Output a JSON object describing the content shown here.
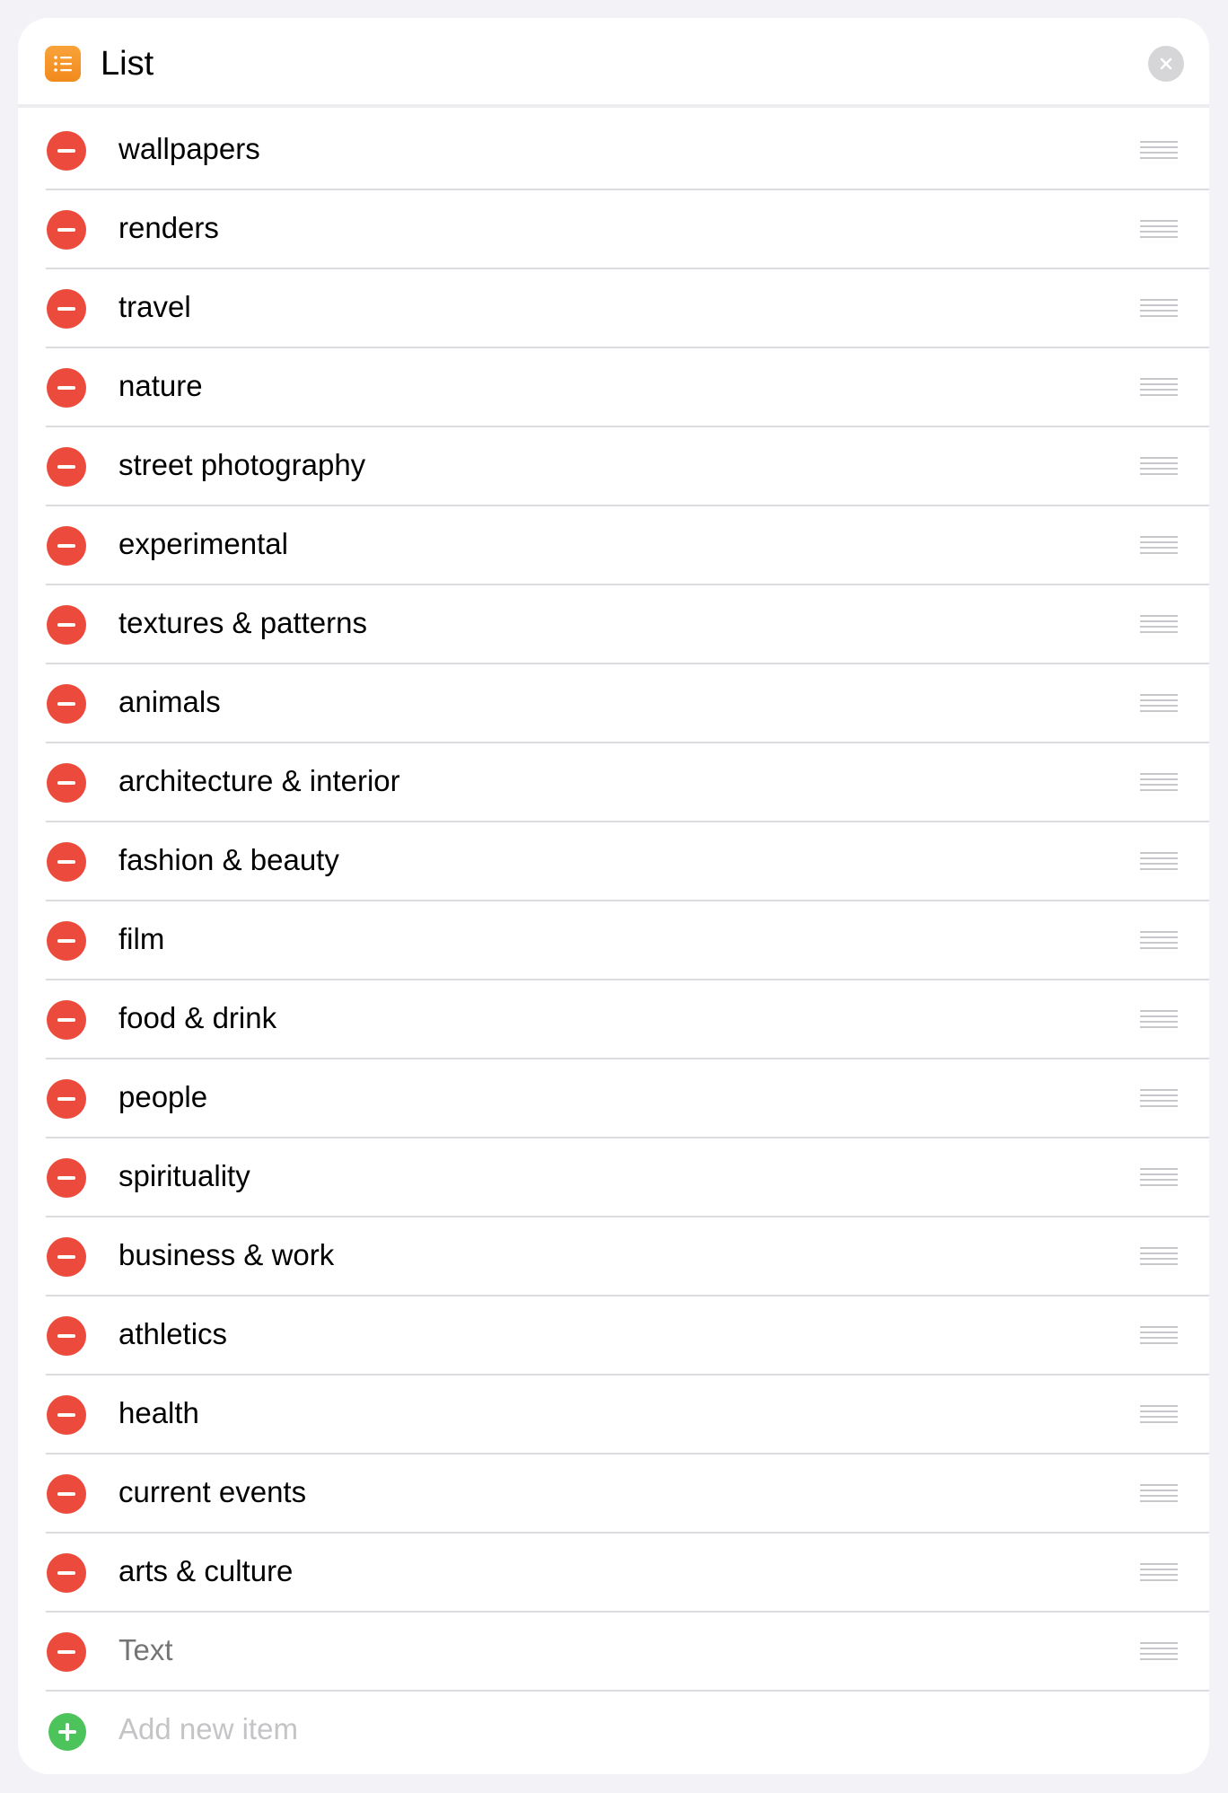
{
  "header": {
    "title": "List",
    "app_icon": "list-icon",
    "close_icon": "close-icon",
    "accent_color": "#f28a1c"
  },
  "items": [
    {
      "label": "wallpapers"
    },
    {
      "label": "renders"
    },
    {
      "label": "travel"
    },
    {
      "label": "nature"
    },
    {
      "label": "street photography"
    },
    {
      "label": "experimental"
    },
    {
      "label": "textures & patterns"
    },
    {
      "label": "animals"
    },
    {
      "label": "architecture & interior"
    },
    {
      "label": "fashion & beauty"
    },
    {
      "label": "film"
    },
    {
      "label": "food & drink"
    },
    {
      "label": "people"
    },
    {
      "label": "spirituality"
    },
    {
      "label": "business & work"
    },
    {
      "label": "athletics"
    },
    {
      "label": "health"
    },
    {
      "label": "current events"
    },
    {
      "label": "arts & culture"
    }
  ],
  "empty_item": {
    "value": "",
    "placeholder": "Text"
  },
  "add_item": {
    "label": "Add new item"
  },
  "colors": {
    "remove": "#ec4a3d",
    "add": "#4cc35b",
    "placeholder": "#c4c4c7"
  }
}
